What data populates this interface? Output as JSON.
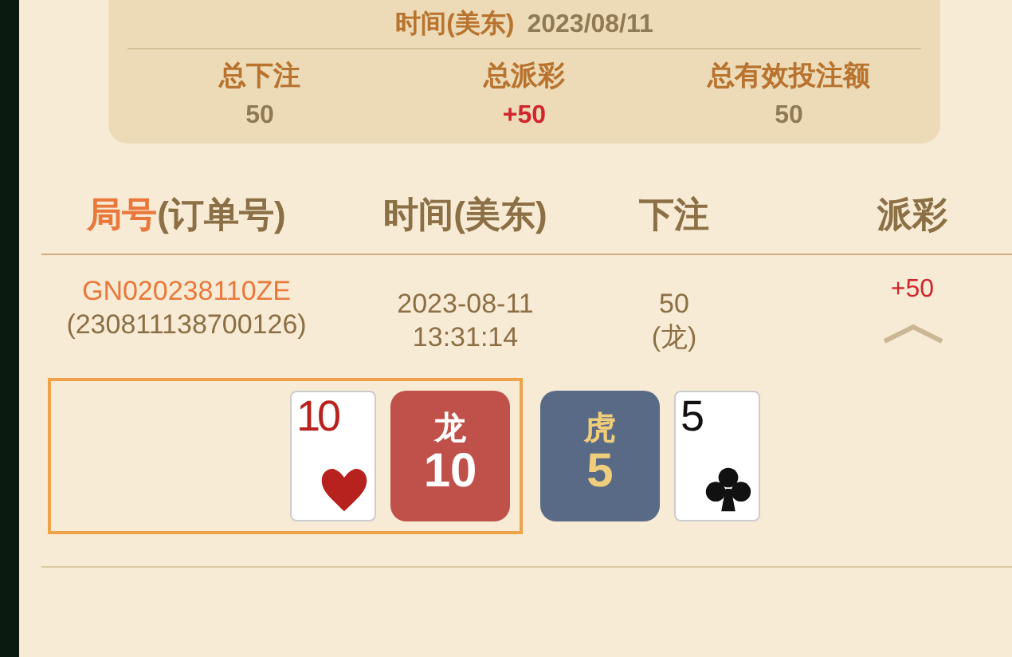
{
  "summary": {
    "time_label": "时间(美东)",
    "date": "2023/08/11",
    "stats": [
      {
        "label": "总下注",
        "value": "50",
        "kind": "plain"
      },
      {
        "label": "总派彩",
        "value": "+50",
        "kind": "win"
      },
      {
        "label": "总有效投注额",
        "value": "50",
        "kind": "plain"
      }
    ]
  },
  "table": {
    "columns": [
      {
        "label": "局号",
        "suffix": "(订单号)"
      },
      {
        "label": "时间(美东)"
      },
      {
        "label": "下注"
      },
      {
        "label": "派彩"
      }
    ],
    "rows": [
      {
        "round_id": "GN020238110ZE",
        "order_number": "(230811138700126)",
        "date": "2023-08-11",
        "time": "13:31:14",
        "bet": "50",
        "bet_side": "(龙)",
        "payout": {
          "text": "+50",
          "kind": "win"
        },
        "expanded": true,
        "hands": [
          {
            "kind": "dragon",
            "label": "龙",
            "score": "10",
            "winner": true,
            "card": {
              "rank": "10",
              "kind": "hearts"
            }
          },
          {
            "kind": "tiger",
            "label": "虎",
            "score": "5",
            "winner": false,
            "card": {
              "rank": "5",
              "kind": "clubs"
            }
          }
        ]
      }
    ]
  }
}
